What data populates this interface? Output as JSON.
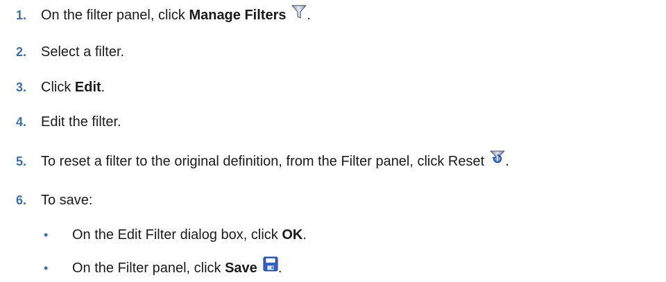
{
  "steps": [
    {
      "num": "1.",
      "pre": "On the filter panel, click ",
      "bold": "Manage Filters",
      "post": "."
    },
    {
      "num": "2.",
      "text": "Select a filter."
    },
    {
      "num": "3.",
      "pre": "Click ",
      "bold": "Edit",
      "post": "."
    },
    {
      "num": "4.",
      "text": "Edit the filter."
    },
    {
      "num": "5.",
      "pre": "To reset a filter to the original definition, from the Filter panel, click Reset",
      "post": "."
    },
    {
      "num": "6.",
      "text": "To save:"
    }
  ],
  "substeps": [
    {
      "bullet": "•",
      "pre": "On the Edit Filter dialog box, click ",
      "bold": "OK",
      "post": "."
    },
    {
      "bullet": "•",
      "pre": "On the Filter panel, click ",
      "bold": "Save",
      "post": "."
    }
  ],
  "icons": {
    "manage_filters": "funnel-icon",
    "reset": "reset-filter-icon",
    "save": "floppy-disk-icon"
  },
  "colors": {
    "step_number": "#3e6fa8",
    "text": "#1a1a1a"
  }
}
